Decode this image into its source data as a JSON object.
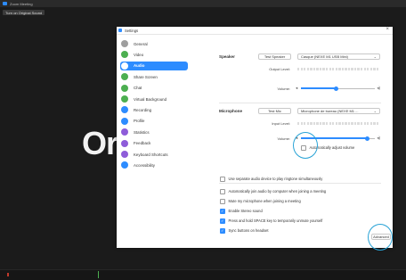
{
  "background": {
    "window_title": "Zoom Meeting",
    "original_sound_label": "Turn on Original Sound",
    "big_text": "Or"
  },
  "settings": {
    "window_title": "Settings",
    "sidebar": [
      {
        "label": "General",
        "icon": "gear-icon",
        "color": "#9e9e9e"
      },
      {
        "label": "Video",
        "icon": "video-icon",
        "color": "#4caf50"
      },
      {
        "label": "Audio",
        "icon": "headphones-icon",
        "color": "#2d8cff",
        "active": true
      },
      {
        "label": "Share Screen",
        "icon": "share-screen-icon",
        "color": "#4caf50"
      },
      {
        "label": "Chat",
        "icon": "chat-icon",
        "color": "#4caf50"
      },
      {
        "label": "Virtual Background",
        "icon": "virtual-background-icon",
        "color": "#4caf50"
      },
      {
        "label": "Recording",
        "icon": "recording-icon",
        "color": "#2d8cff"
      },
      {
        "label": "Profile",
        "icon": "profile-icon",
        "color": "#2d8cff"
      },
      {
        "label": "Statistics",
        "icon": "statistics-icon",
        "color": "#8e5cd9"
      },
      {
        "label": "Feedback",
        "icon": "feedback-icon",
        "color": "#8e5cd9"
      },
      {
        "label": "Keyboard Shortcuts",
        "icon": "keyboard-icon",
        "color": "#8e5cd9"
      },
      {
        "label": "Accessibility",
        "icon": "accessibility-icon",
        "color": "#2d8cff"
      }
    ],
    "speaker": {
      "label": "Speaker",
      "test_button": "Test Speaker",
      "device": "Casque (NEXE M1 USB Mini)",
      "output_level_label": "Output Level:",
      "volume_label": "Volume:",
      "volume_value": 0.48
    },
    "microphone": {
      "label": "Microphone",
      "test_button": "Test Mic",
      "device": "Microphone de bureau (NEXE M1 ...",
      "input_level_label": "Input Level:",
      "volume_label": "Volume:",
      "volume_value": 0.9,
      "auto_adjust_label": "Automatically adjust volume",
      "auto_adjust_checked": false
    },
    "options": [
      {
        "label": "Use separate audio device to play ringtone simultaneously",
        "checked": false
      },
      {
        "label": "Automatically join audio by computer when joining a meeting",
        "checked": false
      },
      {
        "label": "Mute my microphone when joining a meeting",
        "checked": false
      },
      {
        "label": "Enable Stereo sound",
        "checked": true
      },
      {
        "label": "Press and hold SPACE key to temporarily unmute yourself",
        "checked": true
      },
      {
        "label": "Sync buttons on headset",
        "checked": true
      }
    ],
    "advanced_button": "Advanced"
  }
}
